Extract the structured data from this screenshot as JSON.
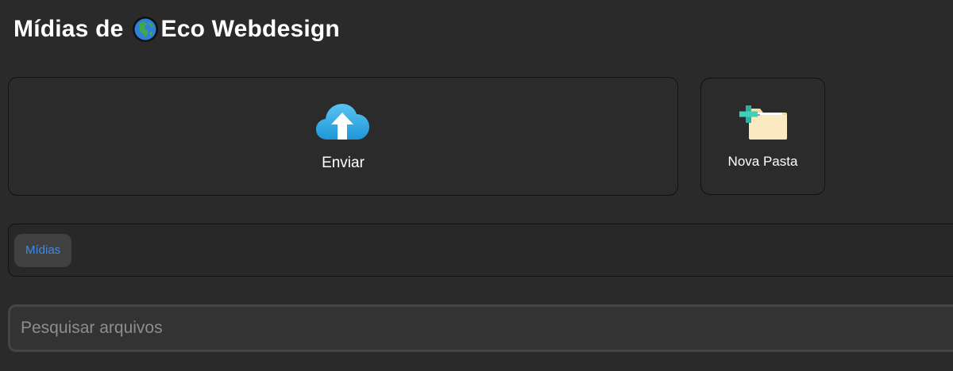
{
  "header": {
    "title_prefix": "Mídias de",
    "title_suffix": "Eco Webdesign",
    "title_icon": "globe-icon"
  },
  "actions": {
    "upload": {
      "label": "Enviar",
      "icon": "cloud-upload-icon"
    },
    "new_folder": {
      "label": "Nova Pasta",
      "icon": "new-folder-icon"
    }
  },
  "breadcrumb": {
    "items": [
      {
        "label": "Mídias"
      }
    ]
  },
  "search": {
    "placeholder": "Pesquisar arquivos",
    "value": ""
  },
  "colors": {
    "background": "#2a2a2a",
    "card": "#2b2b2b",
    "crumb_bg": "#404040",
    "crumb_text": "#3e8be3",
    "cloud": "#2aa6e6",
    "folder": "#f6e2b3"
  }
}
